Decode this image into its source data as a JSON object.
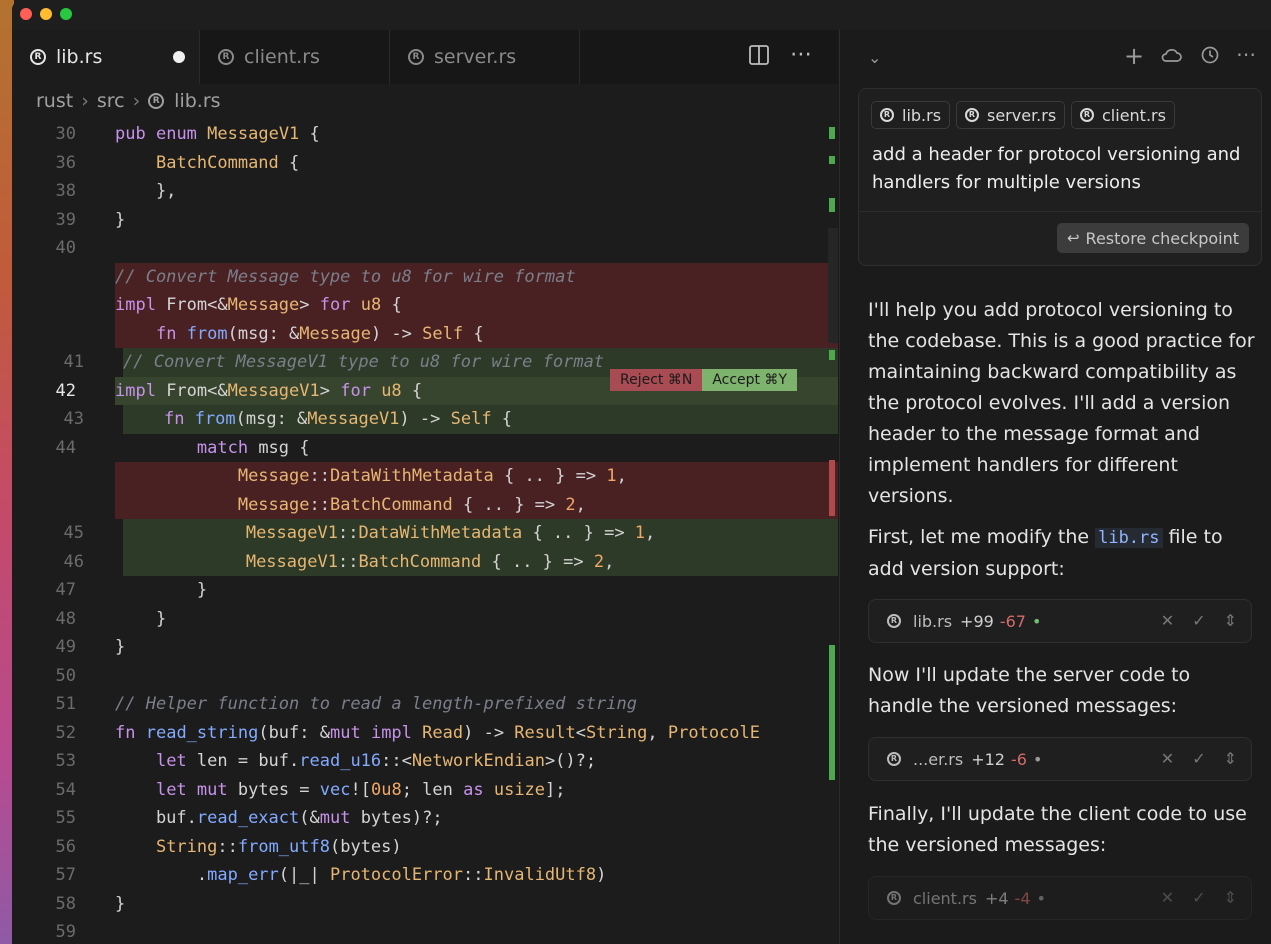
{
  "tabs": [
    {
      "label": "lib.rs",
      "active": true,
      "modified": true
    },
    {
      "label": "client.rs",
      "active": false
    },
    {
      "label": "server.rs",
      "active": false
    }
  ],
  "breadcrumb": [
    "rust",
    "src",
    "lib.rs"
  ],
  "code_lines": [
    {
      "n": "30",
      "t": "pub enum MessageV1 {"
    },
    {
      "n": "36",
      "t": "    BatchCommand {"
    },
    {
      "n": "38",
      "t": "    },"
    },
    {
      "n": "39",
      "t": "}"
    },
    {
      "n": "40",
      "t": ""
    },
    {
      "n": "",
      "t": "// Convert Message type to u8 for wire format"
    },
    {
      "n": "",
      "t": "impl From<&Message> for u8 {"
    },
    {
      "n": "",
      "t": "    fn from(msg: &Message) -> Self {"
    },
    {
      "n": "41",
      "t": "// Convert MessageV1 type to u8 for wire format"
    },
    {
      "n": "42",
      "t": "impl From<&MessageV1> for u8 {"
    },
    {
      "n": "43",
      "t": "    fn from(msg: &MessageV1) -> Self {"
    },
    {
      "n": "44",
      "t": "        match msg {"
    },
    {
      "n": "",
      "t": "            Message::DataWithMetadata { .. } => 1,"
    },
    {
      "n": "",
      "t": "            Message::BatchCommand { .. } => 2,"
    },
    {
      "n": "45",
      "t": "            MessageV1::DataWithMetadata { .. } => 1,"
    },
    {
      "n": "46",
      "t": "            MessageV1::BatchCommand { .. } => 2,"
    },
    {
      "n": "47",
      "t": "        }"
    },
    {
      "n": "48",
      "t": "    }"
    },
    {
      "n": "49",
      "t": "}"
    },
    {
      "n": "50",
      "t": ""
    },
    {
      "n": "51",
      "t": "// Helper function to read a length-prefixed string"
    },
    {
      "n": "52",
      "t": "fn read_string(buf: &mut impl Read) -> Result<String, ProtocolE"
    },
    {
      "n": "53",
      "t": "    let len = buf.read_u16::<NetworkEndian>()?;"
    },
    {
      "n": "54",
      "t": "    let mut bytes = vec![0u8; len as usize];"
    },
    {
      "n": "55",
      "t": "    buf.read_exact(&mut bytes)?;"
    },
    {
      "n": "56",
      "t": "    String::from_utf8(bytes)"
    },
    {
      "n": "57",
      "t": "        .map_err(|_| ProtocolError::InvalidUtf8)"
    },
    {
      "n": "58",
      "t": "}"
    },
    {
      "n": "59",
      "t": ""
    }
  ],
  "diff_actions": {
    "reject": "Reject ⌘N",
    "accept": "Accept ⌘Y"
  },
  "chat": {
    "context_chips": [
      "lib.rs",
      "server.rs",
      "client.rs"
    ],
    "prompt": "add a header for protocol versioning and handlers for multiple versions",
    "restore_label": "Restore checkpoint",
    "msg1": "I'll help you add protocol versioning to the codebase. This is a good practice for maintaining backward compatibility as the protocol evolves. I'll add a version header to the message format and implement handlers for different versions.",
    "msg2_pre": "First, let me modify the ",
    "msg2_code": "lib.rs",
    "msg2_post": " file to add version support:",
    "file1": {
      "name": "lib.rs",
      "add": "+99",
      "rem": "-67"
    },
    "msg3": "Now I'll update the server code to handle the versioned messages:",
    "file2": {
      "name": "...er.rs",
      "add": "+12",
      "rem": "-6"
    },
    "msg4": "Finally, I'll update the client code to use the versioned messages:",
    "file3": {
      "name": "client.rs",
      "add": "+4",
      "rem": "-4"
    }
  }
}
